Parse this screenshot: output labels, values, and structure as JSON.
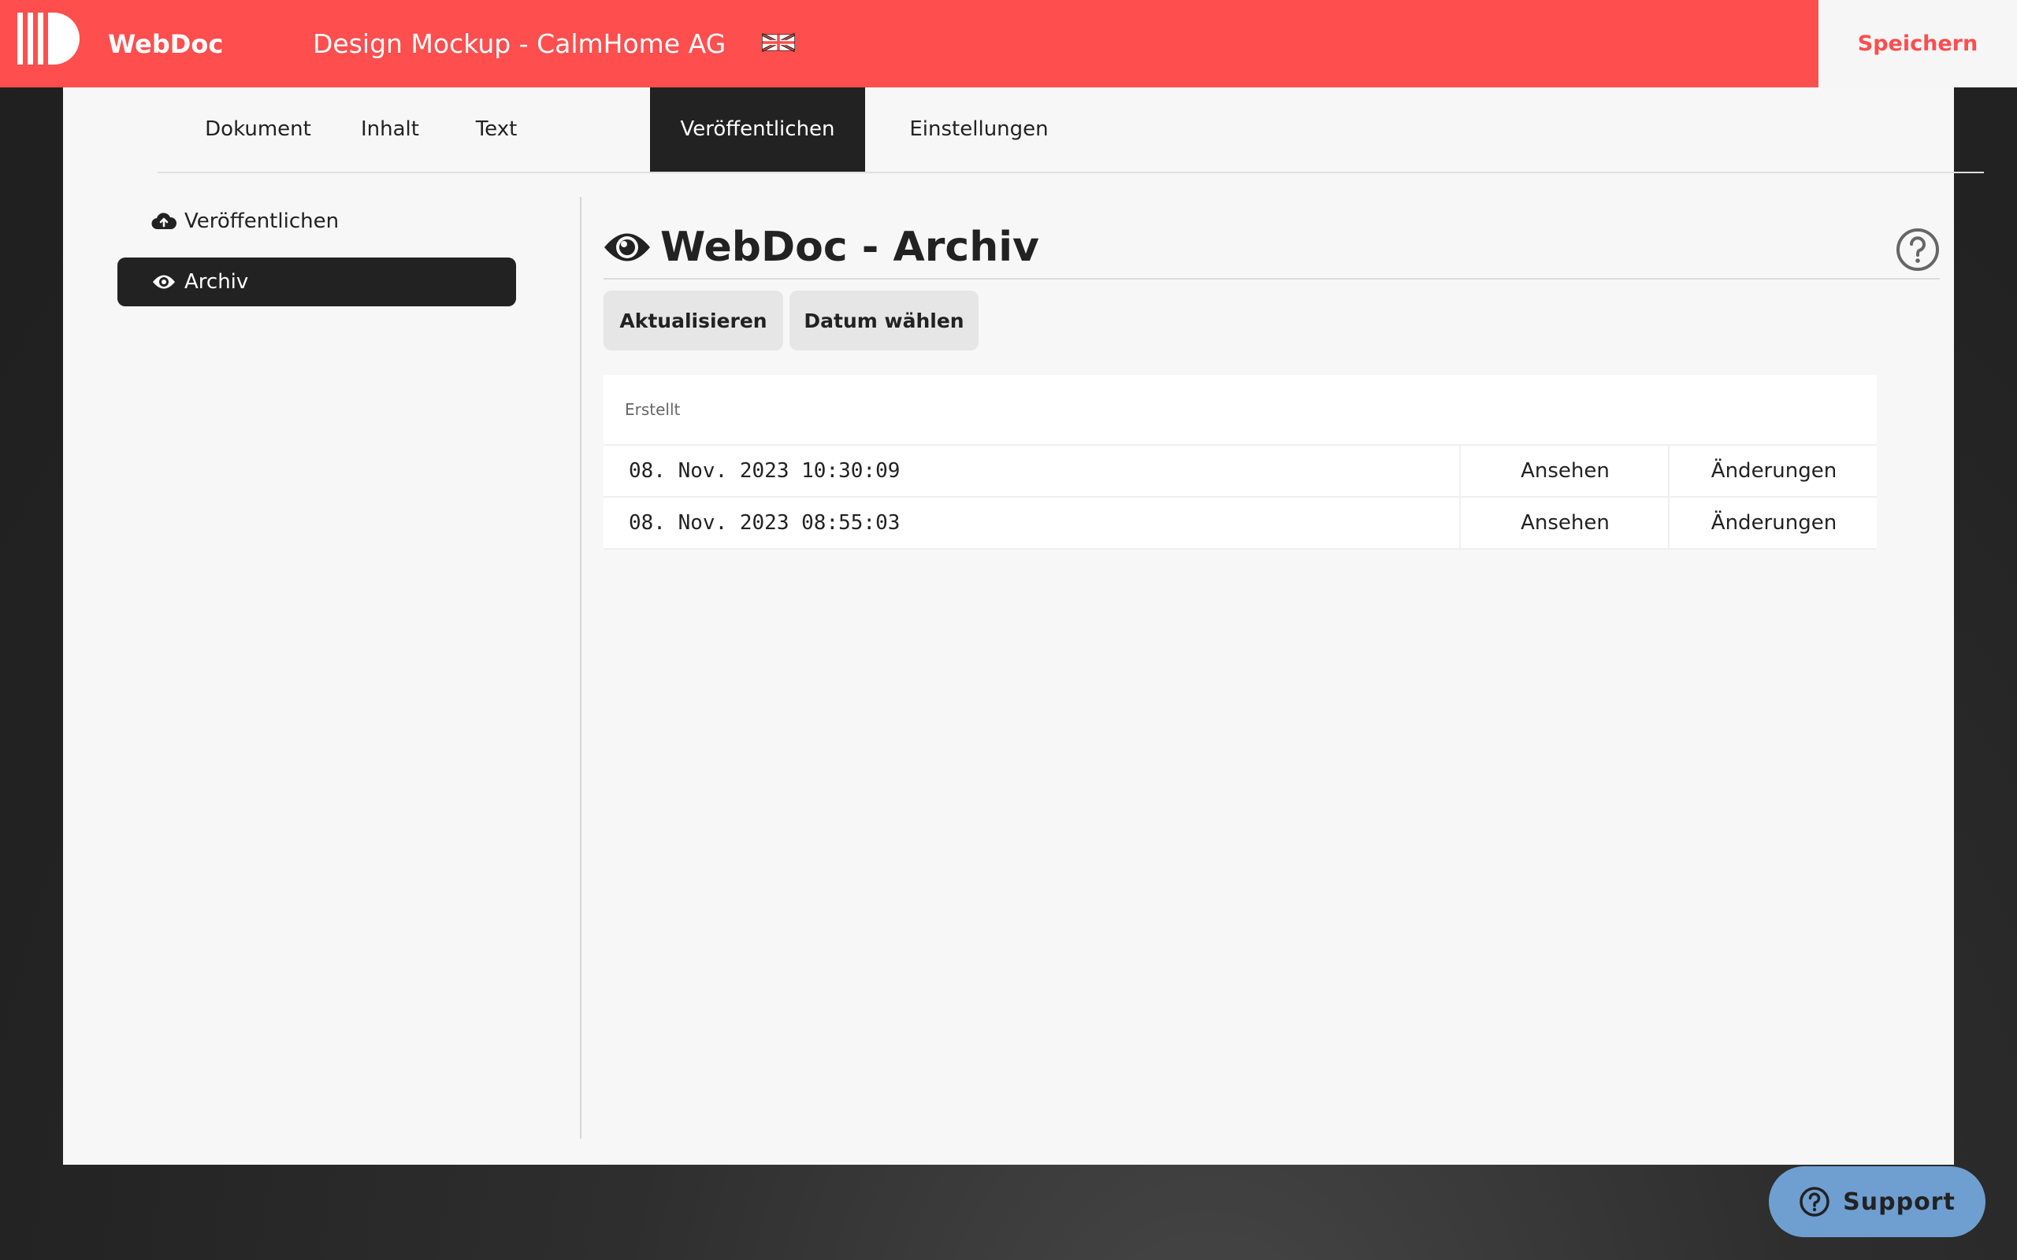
{
  "header": {
    "brand": "WebDoc",
    "document_title": "Design Mockup - CalmHome AG",
    "language_icon": "uk-flag-icon",
    "save_label": "Speichern"
  },
  "tabs": [
    {
      "label": "Dokument",
      "active": false
    },
    {
      "label": "Inhalt",
      "active": false
    },
    {
      "label": "Text",
      "active": false
    },
    {
      "label": "Veröffentlichen",
      "active": true
    },
    {
      "label": "Einstellungen",
      "active": false
    }
  ],
  "sidebar": {
    "items": [
      {
        "label": "Veröffentlichen",
        "icon": "cloud-upload-icon",
        "active": false
      },
      {
        "label": "Archiv",
        "icon": "eye-icon",
        "active": true
      }
    ]
  },
  "main": {
    "title": "WebDoc - Archiv",
    "title_icon": "eye-icon",
    "help_icon": "help-circle-icon",
    "buttons": {
      "refresh": "Aktualisieren",
      "choose_date": "Datum wählen"
    },
    "table": {
      "header": "Erstellt",
      "rows": [
        {
          "date": "08. Nov. 2023 10:30:09",
          "view": "Ansehen",
          "changes": "Änderungen"
        },
        {
          "date": "08. Nov. 2023 08:55:03",
          "view": "Ansehen",
          "changes": "Änderungen"
        }
      ]
    }
  },
  "support": {
    "label": "Support",
    "icon": "question-circle-icon"
  },
  "colors": {
    "accent": "#ff4e4e",
    "dark": "#222222",
    "support": "#6f9fd0"
  }
}
